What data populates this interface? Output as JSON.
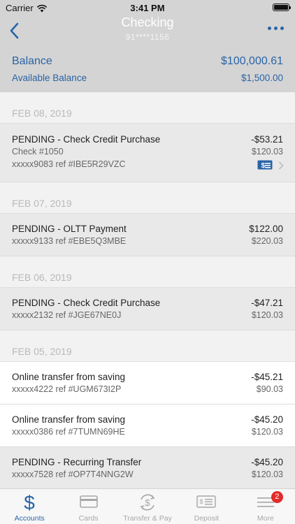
{
  "status": {
    "carrier": "Carrier",
    "time": "3:41 PM"
  },
  "nav": {
    "title": "Checking",
    "account_number": "91****1156"
  },
  "balance": {
    "label": "Balance",
    "value": "$100,000.61",
    "available_label": "Available Balance",
    "available_value": "$1,500.00"
  },
  "groups": [
    {
      "date": "FEB 08, 2019",
      "transactions": [
        {
          "name": "PENDING - Check Credit Purchase",
          "line2": "Check #1050",
          "line3": "xxxxx9083 ref #IBE5R29VZC",
          "amount": "-$53.21",
          "balance": "$120.03"
        }
      ]
    },
    {
      "date": "FEB 07, 2019",
      "transactions": [
        {
          "name": "PENDING - OLTT Payment",
          "line2": "xxxxx9133 ref #EBE5Q3MBE",
          "amount": "$122.00",
          "balance": "$220.03"
        }
      ]
    },
    {
      "date": "FEB 06, 2019",
      "transactions": [
        {
          "name": "PENDING - Check Credit Purchase",
          "line2": "xxxxx2132 ref #JGE67NE0J",
          "amount": "-$47.21",
          "balance": "$120.03"
        }
      ]
    },
    {
      "date": "FEB 05, 2019",
      "transactions": [
        {
          "name": "Online transfer from saving",
          "line2": "xxxxx4222 ref #UGM673I2P",
          "amount": "-$45.21",
          "balance": "$90.03"
        },
        {
          "name": "Online transfer from saving",
          "line2": "xxxxx0386 ref #7TUMN69HE",
          "amount": "-$45.20",
          "balance": "$120.03"
        },
        {
          "name": "PENDING - Recurring Transfer",
          "line2": "xxxxx7528 ref #OP7T4NNG2W",
          "amount": "-$45.20",
          "balance": "$120.03"
        }
      ]
    }
  ],
  "tabs": [
    {
      "label": "Accounts",
      "icon": "dollar-icon"
    },
    {
      "label": "Cards",
      "icon": "card-icon"
    },
    {
      "label": "Transfer & Pay",
      "icon": "transfer-icon"
    },
    {
      "label": "Deposit",
      "icon": "check-deposit-icon"
    },
    {
      "label": "More",
      "icon": "menu-icon",
      "badge": "2"
    }
  ],
  "colors": {
    "accent": "#2a64a6",
    "header": "#d4d4d4",
    "badge": "#e32b2b"
  }
}
